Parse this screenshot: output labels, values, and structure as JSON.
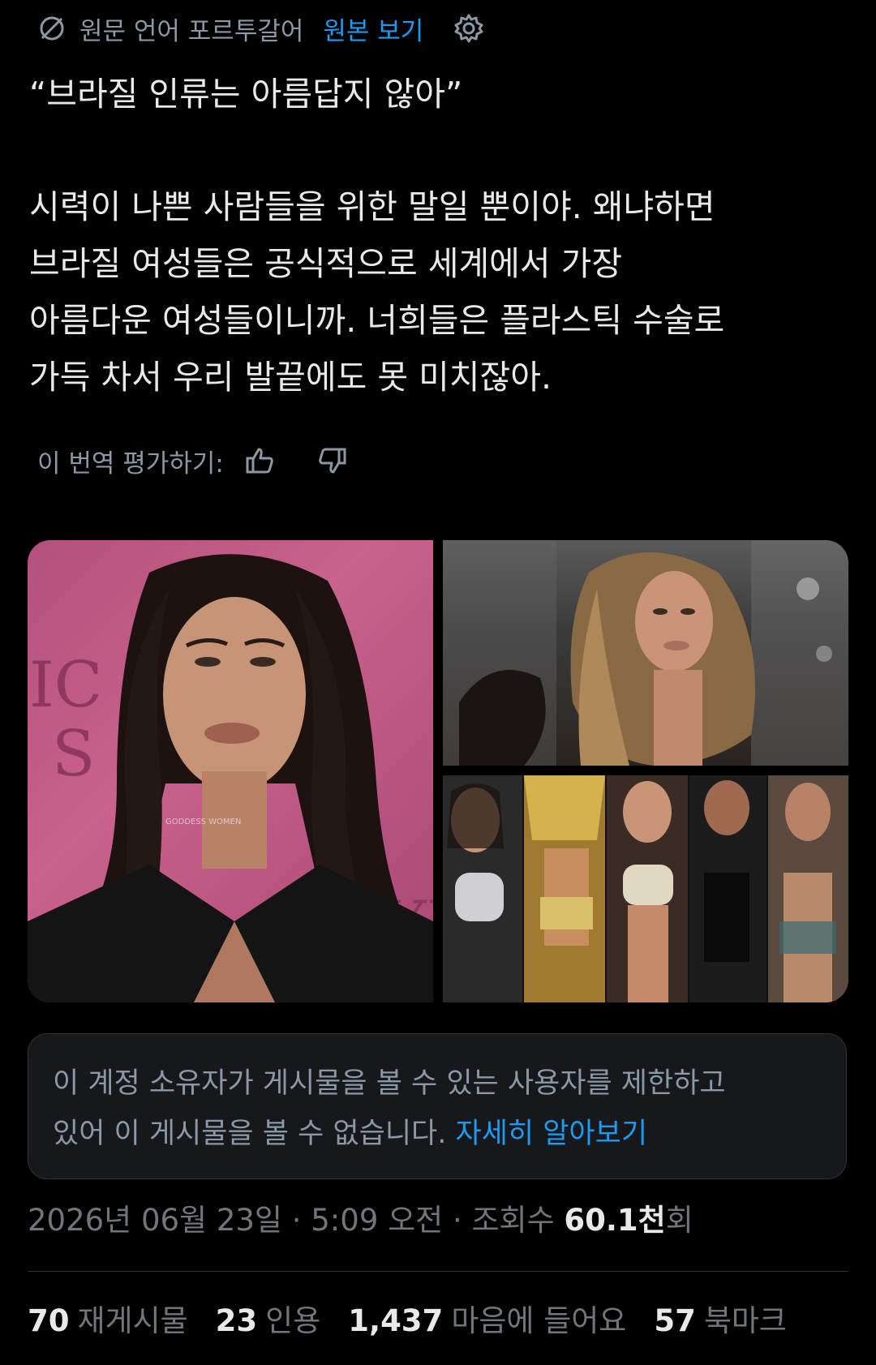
{
  "translation": {
    "source_label": "원문 언어 포르투갈어",
    "show_original": "원본 보기",
    "icons": [
      "translate-icon",
      "gear-icon"
    ]
  },
  "post": {
    "quote": "“브라질 인류는 아름답지 않아”",
    "body_lines": [
      "시력이 나쁜 사람들을 위한 말일 뿐이야. 왜냐하면",
      "브라질 여성들은 공식적으로 세계에서 가장",
      "아름다운 여성들이니까. 너희들은 플라스틱 수술로",
      "가득 차서 우리 발끝에도 못 미치잖아."
    ]
  },
  "rate": {
    "label": "이 번역 평가하기:",
    "icons": [
      "thumbs-up-icon",
      "thumbs-down-icon"
    ]
  },
  "media": {
    "watermark": "GODDESS WOMEN",
    "backdrop_letters_left": [
      "IC",
      "S"
    ],
    "backdrop_letters_right": "YI"
  },
  "restriction": {
    "line1": "이 계정 소유자가 게시물을 볼 수 있는 사용자를 제한하고",
    "line2": "있어 이 게시물을 볼 수 없습니다.",
    "learn_more": "자세히 알아보기"
  },
  "meta": {
    "date": "2026년 06월 23일",
    "time": "5:09 오전",
    "views_label": "조회수",
    "views_value": "60.1천",
    "views_suffix": "회"
  },
  "stats": [
    {
      "value": "70",
      "label": "재게시물"
    },
    {
      "value": "23",
      "label": "인용"
    },
    {
      "value": "1,437",
      "label": "마음에 들어요"
    },
    {
      "value": "57",
      "label": "북마크"
    }
  ],
  "colors": {
    "background": "#000000",
    "text": "#e7e9ea",
    "muted": "#71767b",
    "link": "#1d9bf0",
    "box": "#16181c"
  }
}
